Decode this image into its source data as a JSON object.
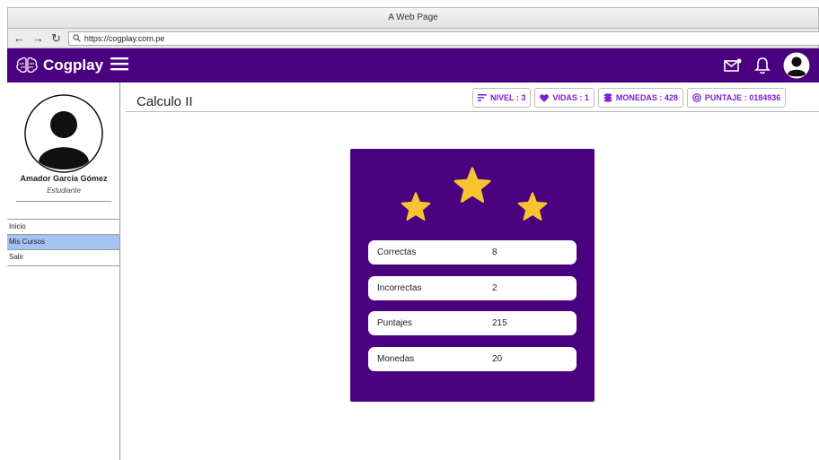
{
  "browser": {
    "window_title": "A Web Page",
    "url": "https://cogplay.com.pe"
  },
  "app": {
    "brand": "Cogplay",
    "accent_color": "#4b007f",
    "icons": [
      "brain-logo-icon",
      "menu-icon",
      "mail-icon",
      "bell-icon",
      "user-avatar-icon"
    ]
  },
  "user": {
    "name": "Amador García Gómez",
    "role": "Estudiante"
  },
  "sidebar": {
    "items": [
      {
        "label": "Inicio",
        "active": false
      },
      {
        "label": "Mis Cursos",
        "active": true
      },
      {
        "label": "Salir",
        "active": false
      }
    ]
  },
  "course": {
    "title": "Calculo II"
  },
  "stats": {
    "nivel": "NIVEL : 3",
    "vidas": "VIDAS : 1",
    "monedas": "MONEDAS : 428",
    "puntaje": "PUNTAJE : 0184936"
  },
  "results": {
    "stars": 3,
    "rows": [
      {
        "label": "Correctas",
        "value": "8"
      },
      {
        "label": "Incorrectas",
        "value": "2"
      },
      {
        "label": "Puntajes",
        "value": "215"
      },
      {
        "label": "Monedas",
        "value": "20"
      }
    ]
  }
}
